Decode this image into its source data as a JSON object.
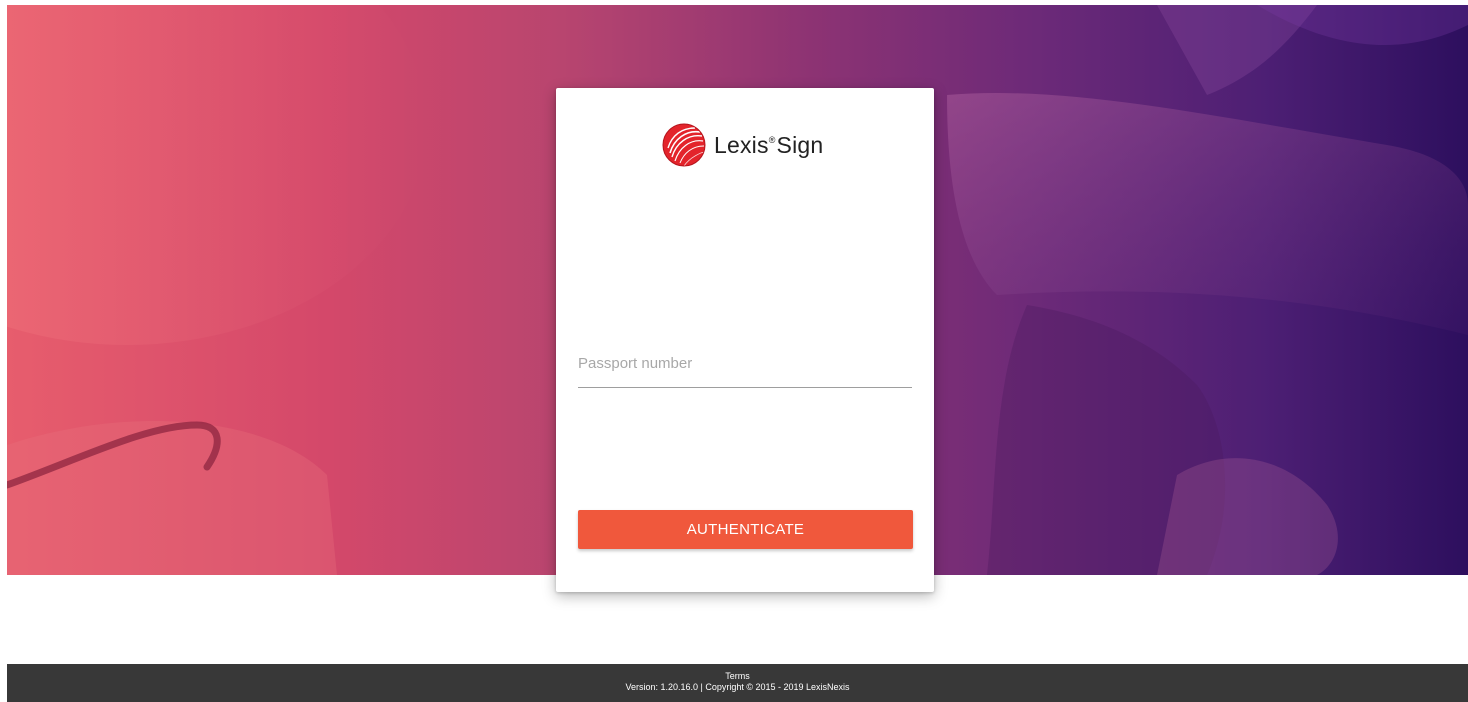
{
  "brand": {
    "name": "Lexis",
    "registered_mark": "®",
    "product": "Sign",
    "logo_icon": "lexisnexis-sphere-icon",
    "accent_color": "#f0583c"
  },
  "form": {
    "passport_placeholder": "Passport number",
    "passport_value": "",
    "submit_label": "AUTHENTICATE"
  },
  "footer": {
    "terms_label": "Terms",
    "version_text": "Version: 1.20.16.0 | Copyright © 2015 - 2019 LexisNexis"
  }
}
